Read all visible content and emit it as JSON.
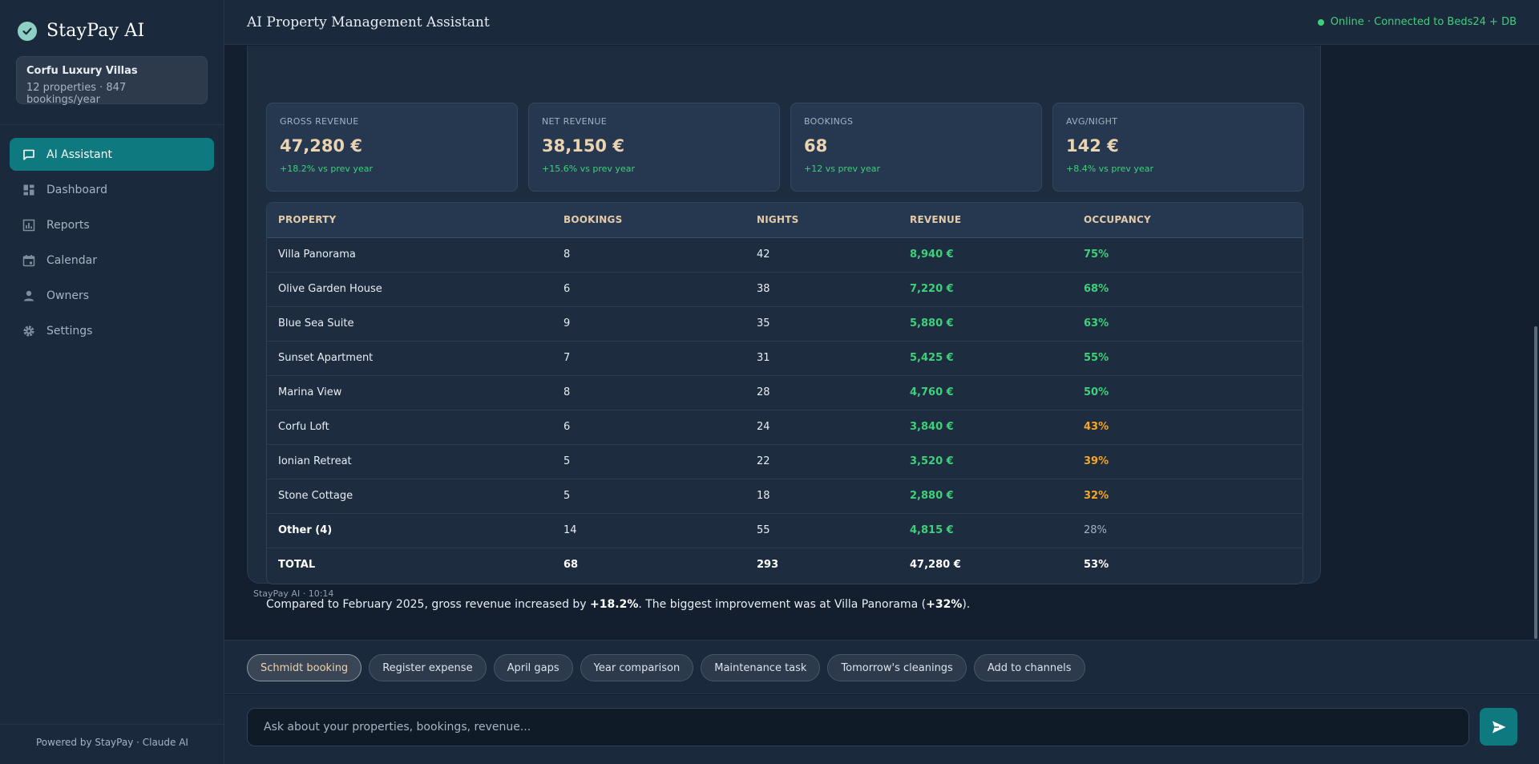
{
  "brand": {
    "name": "StayPay AI"
  },
  "org": {
    "name": "Corfu Luxury Villas",
    "subtitle": "12 properties · 847 bookings/year"
  },
  "nav": [
    {
      "label": "AI Assistant",
      "icon": "chat-icon",
      "active": true
    },
    {
      "label": "Dashboard",
      "icon": "dashboard-icon",
      "active": false
    },
    {
      "label": "Reports",
      "icon": "reports-icon",
      "active": false
    },
    {
      "label": "Calendar",
      "icon": "calendar-icon",
      "active": false
    },
    {
      "label": "Owners",
      "icon": "user-icon",
      "active": false
    },
    {
      "label": "Settings",
      "icon": "gear-icon",
      "active": false
    }
  ],
  "sidebar_footer": "Powered by StayPay · Claude AI",
  "header": {
    "title": "AI Property Management Assistant",
    "status": "Online · Connected to Beds24 + DB"
  },
  "kpis": [
    {
      "label": "GROSS REVENUE",
      "value": "47,280 €",
      "change": "+18.2% vs prev year"
    },
    {
      "label": "NET REVENUE",
      "value": "38,150 €",
      "change": "+15.6% vs prev year"
    },
    {
      "label": "BOOKINGS",
      "value": "68",
      "change": "+12 vs prev year"
    },
    {
      "label": "AVG/NIGHT",
      "value": "142 €",
      "change": "+8.4% vs prev year"
    }
  ],
  "table": {
    "headers": [
      "PROPERTY",
      "BOOKINGS",
      "NIGHTS",
      "REVENUE",
      "OCCUPANCY"
    ],
    "rows": [
      {
        "property": "Villa Panorama",
        "bookings": "8",
        "nights": "42",
        "revenue": "8,940 €",
        "occupancy": "75%"
      },
      {
        "property": "Olive Garden House",
        "bookings": "6",
        "nights": "38",
        "revenue": "7,220 €",
        "occupancy": "68%"
      },
      {
        "property": "Blue Sea Suite",
        "bookings": "9",
        "nights": "35",
        "revenue": "5,880 €",
        "occupancy": "63%"
      },
      {
        "property": "Sunset Apartment",
        "bookings": "7",
        "nights": "31",
        "revenue": "5,425 €",
        "occupancy": "55%"
      },
      {
        "property": "Marina View",
        "bookings": "8",
        "nights": "28",
        "revenue": "4,760 €",
        "occupancy": "50%"
      },
      {
        "property": "Corfu Loft",
        "bookings": "6",
        "nights": "24",
        "revenue": "3,840 €",
        "occupancy": "43%"
      },
      {
        "property": "Ionian Retreat",
        "bookings": "5",
        "nights": "22",
        "revenue": "3,520 €",
        "occupancy": "39%"
      },
      {
        "property": "Stone Cottage",
        "bookings": "5",
        "nights": "18",
        "revenue": "2,880 €",
        "occupancy": "32%"
      },
      {
        "property": "Other (4)",
        "bookings": "14",
        "nights": "55",
        "revenue": "4,815 €",
        "occupancy": "28%"
      }
    ],
    "total": {
      "property": "TOTAL",
      "bookings": "68",
      "nights": "293",
      "revenue": "47,280 €",
      "occupancy": "53%"
    }
  },
  "summary": {
    "part1": "Compared to February 2025, gross revenue increased by ",
    "highlight1": "+18.2%",
    "part2": ". The biggest improvement was at Villa Panorama (",
    "highlight2": "+32%",
    "part3": ")."
  },
  "message_meta": "StayPay AI · 10:14",
  "chips": [
    "Schmidt booking",
    "Register expense",
    "April gaps",
    "Year comparison",
    "Maintenance task",
    "Tomorrow's cleanings",
    "Add to channels"
  ],
  "input": {
    "value": "",
    "placeholder": "Ask about your properties, bookings, revenue..."
  },
  "colors": {
    "accent": "#0e7a80",
    "positive": "#3fd07a",
    "warning": "#f5a623",
    "gold": "#ecd3b0"
  }
}
